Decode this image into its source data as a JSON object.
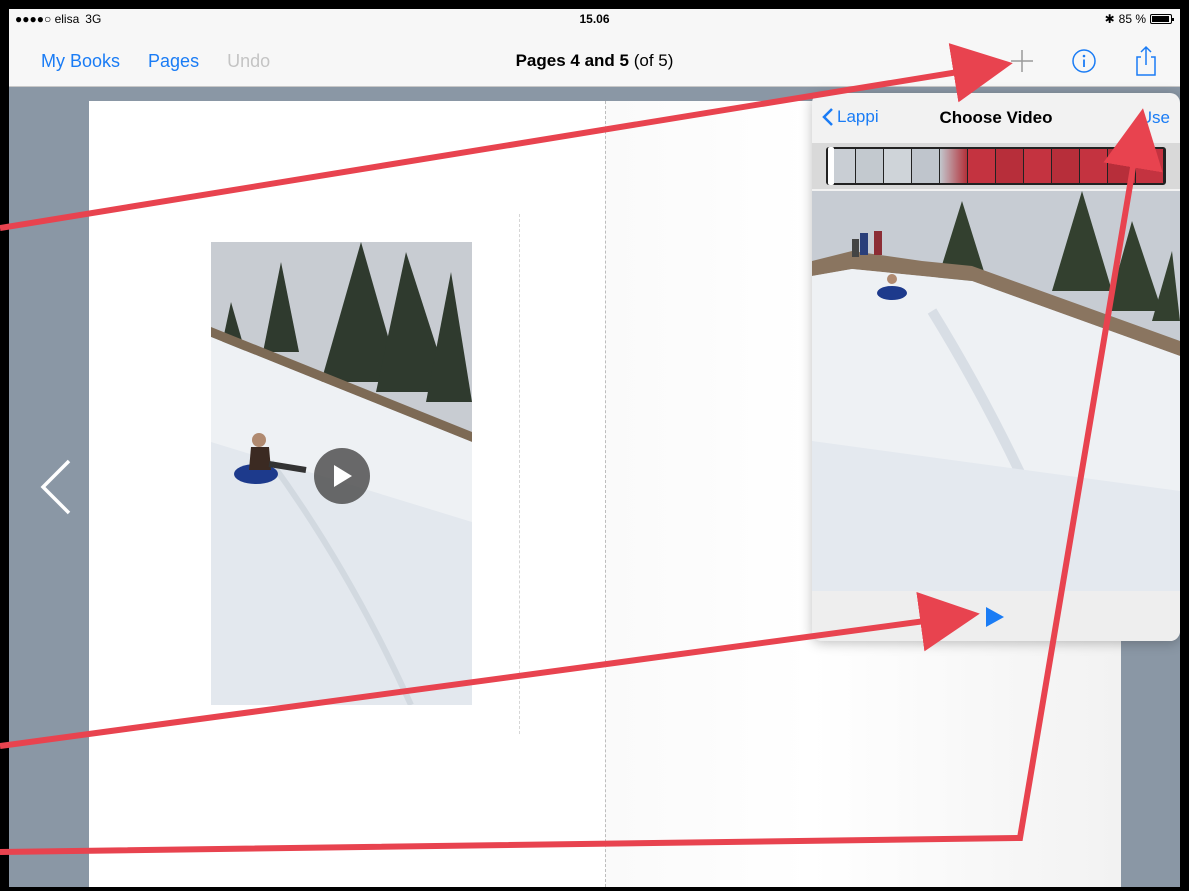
{
  "statusbar": {
    "carrier": "●●●●○ elisa",
    "network": "3G",
    "time": "15.06",
    "battery": "85 %",
    "battery_level": 0.85
  },
  "navbar": {
    "my_books": "My Books",
    "pages": "Pages",
    "undo": "Undo",
    "title_bold": "Pages 4 and 5",
    "title_rest": " (of 5)"
  },
  "icons": {
    "add": "plus-icon",
    "info": "info-icon",
    "share": "share-icon",
    "prev": "chevron-left-icon",
    "play": "play-icon"
  },
  "popover": {
    "back_label": "Lappi",
    "title": "Choose Video",
    "use_label": "Use"
  },
  "colors": {
    "accent": "#1a7cf5",
    "annotation": "#e8434f",
    "background": "#8a97a5"
  }
}
